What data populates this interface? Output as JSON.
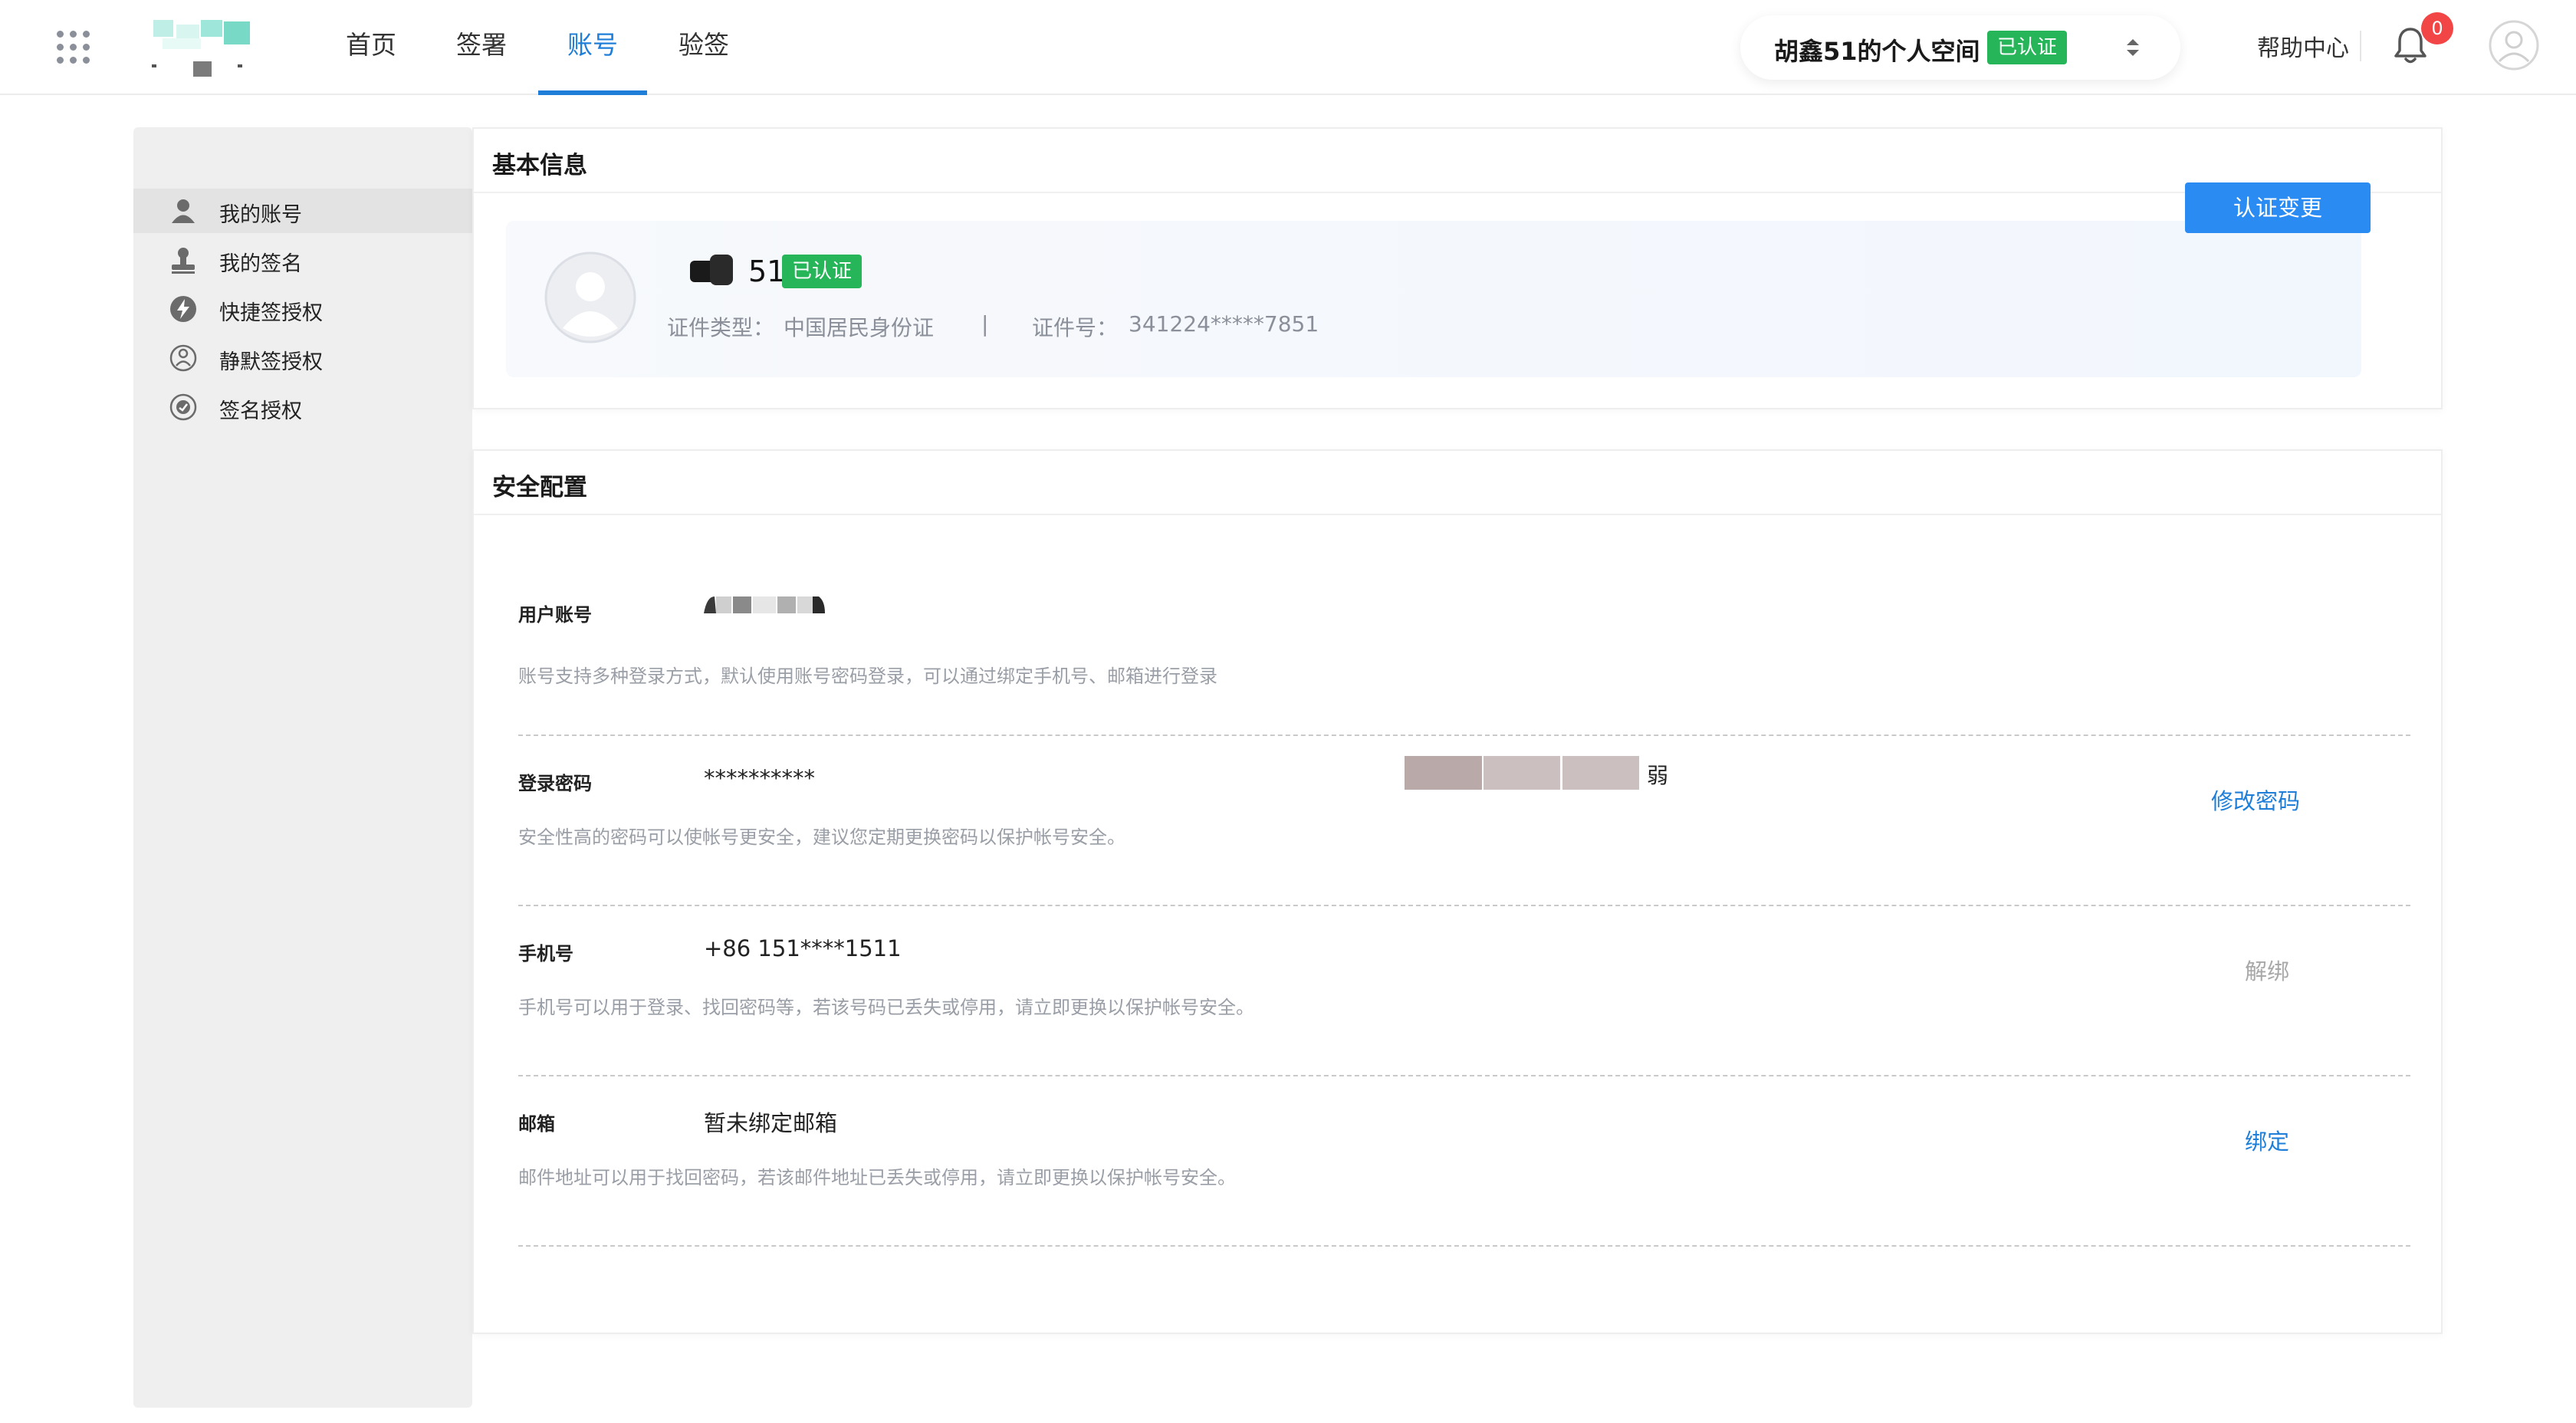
{
  "nav": {
    "tabs": [
      {
        "label": "首页"
      },
      {
        "label": "签署"
      },
      {
        "label": "账号"
      },
      {
        "label": "验签"
      }
    ],
    "active_tab": "账号"
  },
  "space": {
    "name": "胡鑫51的个人空间",
    "badge": "已认证"
  },
  "header": {
    "help": "帮助中心",
    "notification_count": "0"
  },
  "sidebar": {
    "items": [
      {
        "label": "我的账号",
        "icon": "user-icon"
      },
      {
        "label": "我的签名",
        "icon": "stamp-icon"
      },
      {
        "label": "快捷签授权",
        "icon": "lightning-icon"
      },
      {
        "label": "静默签授权",
        "icon": "silent-sign-icon"
      },
      {
        "label": "签名授权",
        "icon": "signature-auth-icon"
      }
    ]
  },
  "basic_info": {
    "title": "基本信息",
    "name_suffix": "51",
    "badge": "已认证",
    "id_type_label": "证件类型：",
    "id_type_value": "中国居民身份证",
    "separator": "|",
    "id_no_label": "证件号：",
    "id_no_value": "341224*****7851",
    "change_button": "认证变更"
  },
  "security": {
    "title": "安全配置",
    "account": {
      "label": "用户账号",
      "desc": "账号支持多种登录方式，默认使用账号密码登录，可以通过绑定手机号、邮箱进行登录"
    },
    "password": {
      "label": "登录密码",
      "value": "**********",
      "strength": "弱",
      "strength_level": 0.33,
      "desc": "安全性高的密码可以使帐号更安全，建议您定期更换密码以保护帐号安全。",
      "action": "修改密码"
    },
    "phone": {
      "label": "手机号",
      "value": "+86 151****1511",
      "desc": "手机号可以用于登录、找回密码等，若该号码已丢失或停用，请立即更换以保护帐号安全。",
      "action": "解绑"
    },
    "email": {
      "label": "邮箱",
      "value": "暂未绑定邮箱",
      "desc": "邮件地址可以用于找回密码，若该邮件地址已丢失或停用，请立即更换以保护帐号安全。",
      "action": "绑定"
    }
  },
  "colors": {
    "accent": "#1f7fd8",
    "primary_button": "#2a8bf2",
    "verified": "#27b559",
    "notification": "#f24545"
  }
}
